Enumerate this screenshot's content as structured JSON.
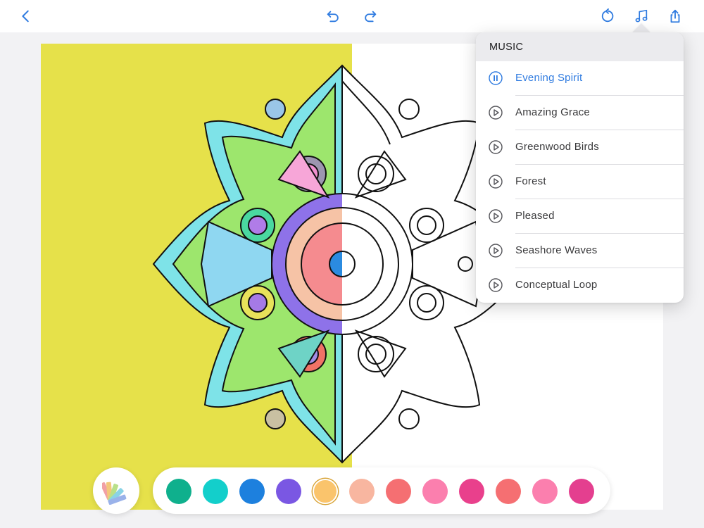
{
  "toolbar": {
    "back": "chevron-left-icon",
    "undo": "undo-icon",
    "redo": "redo-icon",
    "reset": "reset-icon",
    "music": "music-note-icon",
    "share": "share-icon"
  },
  "colors": {
    "accent": "#2f7be0",
    "canvas_fill": "#e6e14a"
  },
  "music": {
    "title": "MUSIC",
    "tracks": [
      {
        "name": "Evening Spirit",
        "state": "playing",
        "icon": "pause-icon"
      },
      {
        "name": "Amazing Grace",
        "state": "stopped",
        "icon": "play-icon"
      },
      {
        "name": "Greenwood Birds",
        "state": "stopped",
        "icon": "play-icon"
      },
      {
        "name": "Forest",
        "state": "stopped",
        "icon": "play-icon"
      },
      {
        "name": "Pleased",
        "state": "stopped",
        "icon": "play-icon"
      },
      {
        "name": "Seashore Waves",
        "state": "stopped",
        "icon": "play-icon"
      },
      {
        "name": "Conceptual Loop",
        "state": "stopped",
        "icon": "play-icon"
      }
    ]
  },
  "palette": {
    "picker_icon": "color-fan-icon",
    "selected_index": 4,
    "swatches": [
      "#0fb08d",
      "#13cfcb",
      "#1d80de",
      "#7a57e3",
      "#fac46c",
      "#f8b6a0",
      "#f56f72",
      "#fb7fae",
      "#e9408c",
      "#f56f72",
      "#fb7fae",
      "#e43f8f"
    ]
  }
}
